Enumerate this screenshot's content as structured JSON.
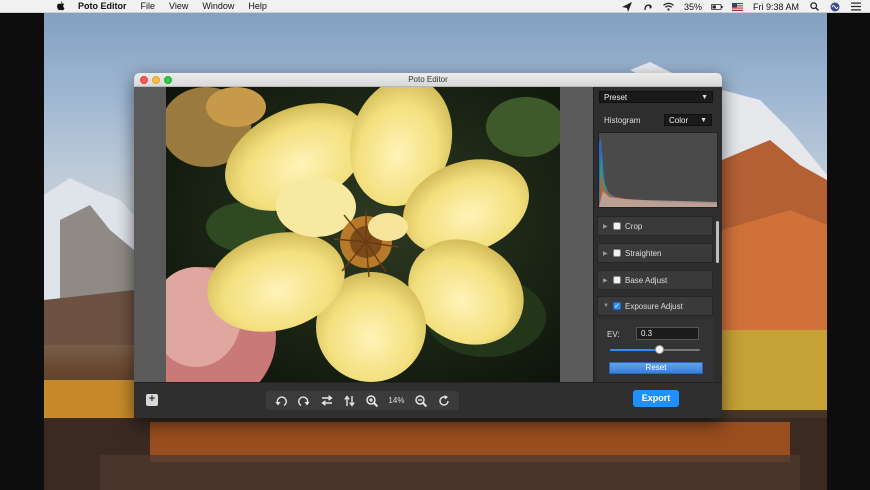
{
  "menubar": {
    "app_name": "Poto Editor",
    "items": [
      "File",
      "View",
      "Window",
      "Help"
    ],
    "battery": "35%",
    "clock": "Fri 9:38 AM"
  },
  "window": {
    "title": "Poto Editor"
  },
  "sidebar": {
    "preset_label": "Preset",
    "histogram_label": "Histogram",
    "histogram_mode": "Color",
    "sections": [
      {
        "label": "Crop",
        "checked": false,
        "expanded": false
      },
      {
        "label": "Straighten",
        "checked": false,
        "expanded": false
      },
      {
        "label": "Base Adjust",
        "checked": false,
        "expanded": false
      },
      {
        "label": "Exposure Adjust",
        "checked": true,
        "expanded": true
      }
    ],
    "exposure": {
      "ev_label": "EV:",
      "ev_value": "0.3",
      "slider_fraction": 0.55,
      "reset_label": "Reset"
    }
  },
  "toolbar": {
    "add_label": "+",
    "zoom_level": "14%",
    "export_label": "Export"
  },
  "icons": {
    "apple": "apple-icon",
    "rotate_left": "rotate-left-icon",
    "rotate_right": "rotate-right-icon",
    "flip_horizontal": "flip-horizontal-icon",
    "flip_vertical": "flip-vertical-icon",
    "zoom_in": "zoom-in-icon",
    "zoom_out": "zoom-out-icon",
    "reset_view": "refresh-icon"
  },
  "colors": {
    "accent": "#1e90ff",
    "checkbox_on": "#2f8ef5"
  }
}
